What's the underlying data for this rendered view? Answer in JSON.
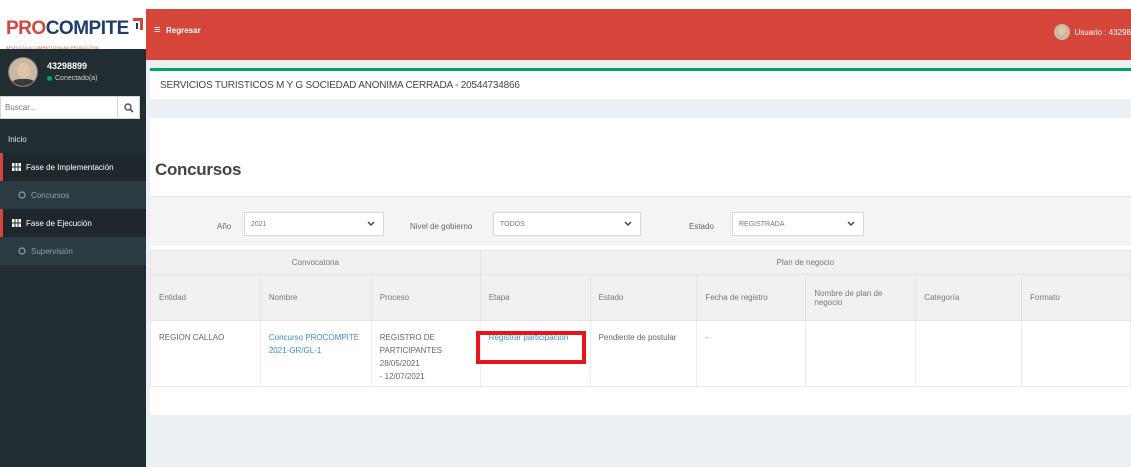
{
  "brand": {
    "pro": "PRO",
    "compite": "COMPITE",
    "tagline": "APOYO A LA COMPETITIVIDAD PRODUCTIVA"
  },
  "user": {
    "name": "43298899",
    "status": "Conectado(a)"
  },
  "sidebar": {
    "search_placeholder": "Buscar...",
    "items": [
      {
        "label": "Inicio"
      },
      {
        "label": "Fase de Implementación"
      },
      {
        "label": "Concursos"
      },
      {
        "label": "Fase de Ejecución"
      },
      {
        "label": "Supervisión"
      }
    ]
  },
  "header": {
    "back_label": "Regresar",
    "user_label": "Usuario : 43298"
  },
  "company": {
    "name": "SERVICIOS TURISTICOS M Y G SOCIEDAD ANONIMA CERRADA - 20544734866"
  },
  "page": {
    "title": "Concursos"
  },
  "filters": {
    "year_label": "Año",
    "year_value": "2021",
    "level_label": "Nivel de gobierno",
    "level_value": "TODOS",
    "state_label": "Estado",
    "state_value": "REGISTRADA"
  },
  "table": {
    "groups": [
      "Convocatoria",
      "Plan de negocio"
    ],
    "headers": [
      "Entidad",
      "Nombre",
      "Proceso",
      "Etapa",
      "Estado",
      "Fecha de registro",
      "Nombre de plan de negocio",
      "Categoría",
      "Formato"
    ],
    "rows": [
      {
        "entidad": "REGION CALLAO",
        "nombre_1": "Concurso PROCOMPITE",
        "nombre_2": "2021-GR/GL-1",
        "proceso_1": "REGISTRO DE",
        "proceso_2": "PARTICIPANTES 28/05/2021",
        "proceso_3": "- 12/07/2021",
        "etapa": "Registrar participación",
        "estado": "Pendiente de postular",
        "fecha": "-",
        "plan": "",
        "categoria": "",
        "formato": ""
      }
    ]
  },
  "colors": {
    "header": "#d6453a",
    "sidebar": "#222d32",
    "highlight": "#e8141c",
    "link": "#3c8dbc",
    "accent_green": "#00a65a"
  },
  "icons": [
    "menu-icon",
    "search-icon",
    "grid-icon",
    "circle-icon",
    "chevron-down-icon",
    "user-avatar-icon"
  ]
}
